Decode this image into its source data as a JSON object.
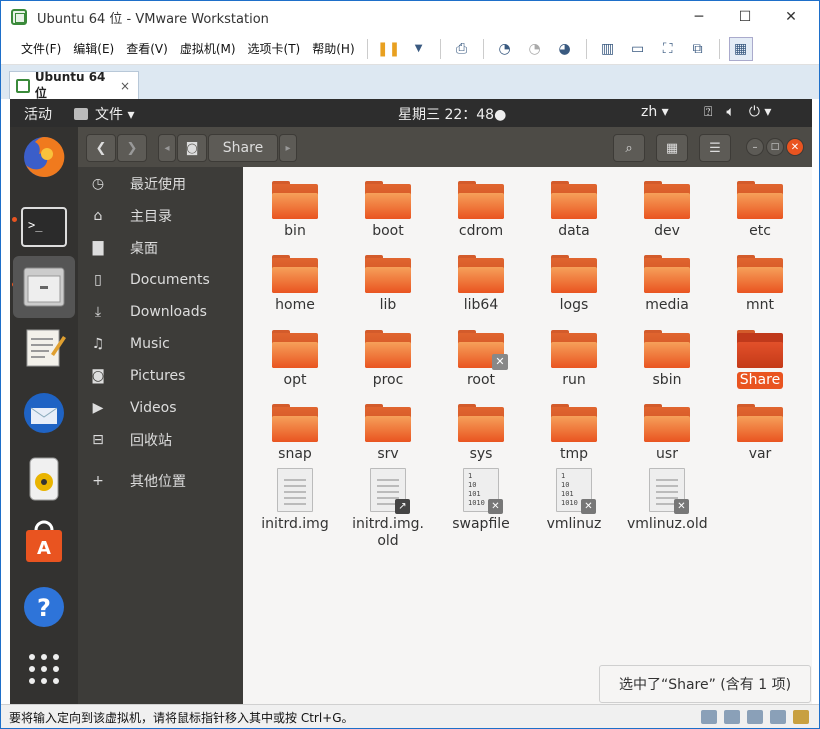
{
  "vmware": {
    "title": "Ubuntu 64 位 - VMware Workstation",
    "menus": [
      "文件(F)",
      "编辑(E)",
      "查看(V)",
      "虚拟机(M)",
      "选项卡(T)",
      "帮助(H)"
    ],
    "tab_label": "Ubuntu 64 位",
    "tab_close": "×",
    "status_text": "要将输入定向到该虚拟机，请将鼠标指针移入其中或按 Ctrl+G。"
  },
  "topbar": {
    "activities": "活动",
    "app_menu": "文件 ▾",
    "clock": "星期三 22：48●",
    "lang": "zh ▾"
  },
  "nautilus": {
    "path_label": "Share",
    "sidebar": [
      {
        "icon": "clock-icon",
        "glyph": "◷",
        "label": "最近使用"
      },
      {
        "icon": "home-icon",
        "glyph": "⌂",
        "label": "主目录"
      },
      {
        "icon": "folder-icon",
        "glyph": "▇",
        "label": "桌面"
      },
      {
        "icon": "document-icon",
        "glyph": "▯",
        "label": "Documents"
      },
      {
        "icon": "download-icon",
        "glyph": "⤓",
        "label": "Downloads"
      },
      {
        "icon": "music-icon",
        "glyph": "♫",
        "label": "Music"
      },
      {
        "icon": "camera-icon",
        "glyph": "◙",
        "label": "Pictures"
      },
      {
        "icon": "video-icon",
        "glyph": "▶",
        "label": "Videos"
      },
      {
        "icon": "trash-icon",
        "glyph": "⊟",
        "label": "回收站"
      },
      {
        "icon": "plus-icon",
        "glyph": "+",
        "label": "其他位置"
      }
    ],
    "files": [
      {
        "name": "bin",
        "kind": "folder"
      },
      {
        "name": "boot",
        "kind": "folder"
      },
      {
        "name": "cdrom",
        "kind": "folder"
      },
      {
        "name": "data",
        "kind": "folder"
      },
      {
        "name": "dev",
        "kind": "folder"
      },
      {
        "name": "etc",
        "kind": "folder"
      },
      {
        "name": "home",
        "kind": "folder"
      },
      {
        "name": "lib",
        "kind": "folder"
      },
      {
        "name": "lib64",
        "kind": "folder"
      },
      {
        "name": "logs",
        "kind": "folder"
      },
      {
        "name": "media",
        "kind": "folder"
      },
      {
        "name": "mnt",
        "kind": "folder"
      },
      {
        "name": "opt",
        "kind": "folder"
      },
      {
        "name": "proc",
        "kind": "folder"
      },
      {
        "name": "root",
        "kind": "folder-locked"
      },
      {
        "name": "run",
        "kind": "folder"
      },
      {
        "name": "sbin",
        "kind": "folder"
      },
      {
        "name": "Share",
        "kind": "folder-selected"
      },
      {
        "name": "snap",
        "kind": "folder"
      },
      {
        "name": "srv",
        "kind": "folder"
      },
      {
        "name": "sys",
        "kind": "folder"
      },
      {
        "name": "tmp",
        "kind": "folder"
      },
      {
        "name": "usr",
        "kind": "folder"
      },
      {
        "name": "var",
        "kind": "folder"
      },
      {
        "name": "initrd.img",
        "kind": "text"
      },
      {
        "name": "initrd.img.old",
        "kind": "text-link"
      },
      {
        "name": "swapfile",
        "kind": "binary-locked"
      },
      {
        "name": "vmlinuz",
        "kind": "binary-link-locked"
      },
      {
        "name": "vmlinuz.old",
        "kind": "text-link-locked"
      }
    ],
    "status_popup": "选中了“Share” (含有 1 项)"
  },
  "colors": {
    "accent": "#e95420",
    "sidebar_bg": "#3d3c39",
    "headerbar_bg": "#4d4b46"
  }
}
